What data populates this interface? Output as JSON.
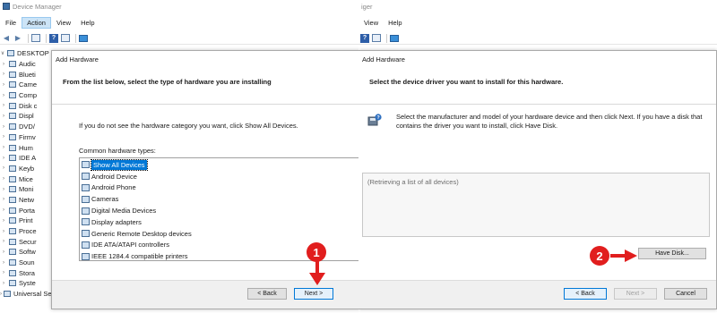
{
  "left": {
    "title": "Device Manager",
    "menu": [
      "File",
      "Action",
      "View",
      "Help"
    ],
    "active_menu": "Action",
    "tree_root": "DESKTOP",
    "tree": [
      "Audic",
      "Blueti",
      "Came",
      "Comp",
      "Disk c",
      "Displ",
      "DVD/",
      "Firmv",
      "Hum",
      "IDE A",
      "Keyb",
      "Mice",
      "Moni",
      "Netw",
      "Porta",
      "Print",
      "Proce",
      "Secur",
      "Softw",
      "Soun",
      "Stora",
      "Syste",
      "Universal Serial Bus controllers"
    ],
    "dialog": {
      "title": "Add Hardware",
      "heading": "From the list below, select the type of hardware you are installing",
      "hint": "If you do not see the hardware category you want, click Show All Devices.",
      "list_label": "Common hardware types:",
      "items": [
        "Show All Devices",
        "Android Device",
        "Android Phone",
        "Cameras",
        "Digital Media Devices",
        "Display adapters",
        "Generic Remote Desktop devices",
        "IDE ATA/ATAPI controllers",
        "IEEE 1284.4 compatible printers"
      ],
      "selected_item": "Show All Devices",
      "back_label": "< Back",
      "next_label": "Next >"
    },
    "step_marker": "1"
  },
  "right": {
    "title": "iger",
    "menu": [
      "View",
      "Help"
    ],
    "dialog": {
      "title": "Add Hardware",
      "heading": "Select the device driver you want to install for this hardware.",
      "info_text": "Select the manufacturer and model of your hardware device and then click Next. If you have a disk that contains the driver you want to install, click Have Disk.",
      "list_status": "(Retrieving a list of all devices)",
      "have_disk_label": "Have Disk...",
      "back_label": "< Back",
      "next_label": "Next >",
      "cancel_label": "Cancel"
    },
    "step_marker": "2"
  },
  "colors": {
    "marker": "#e11e1e",
    "selection": "#0078d7",
    "menu_active": "#cce4f7"
  }
}
